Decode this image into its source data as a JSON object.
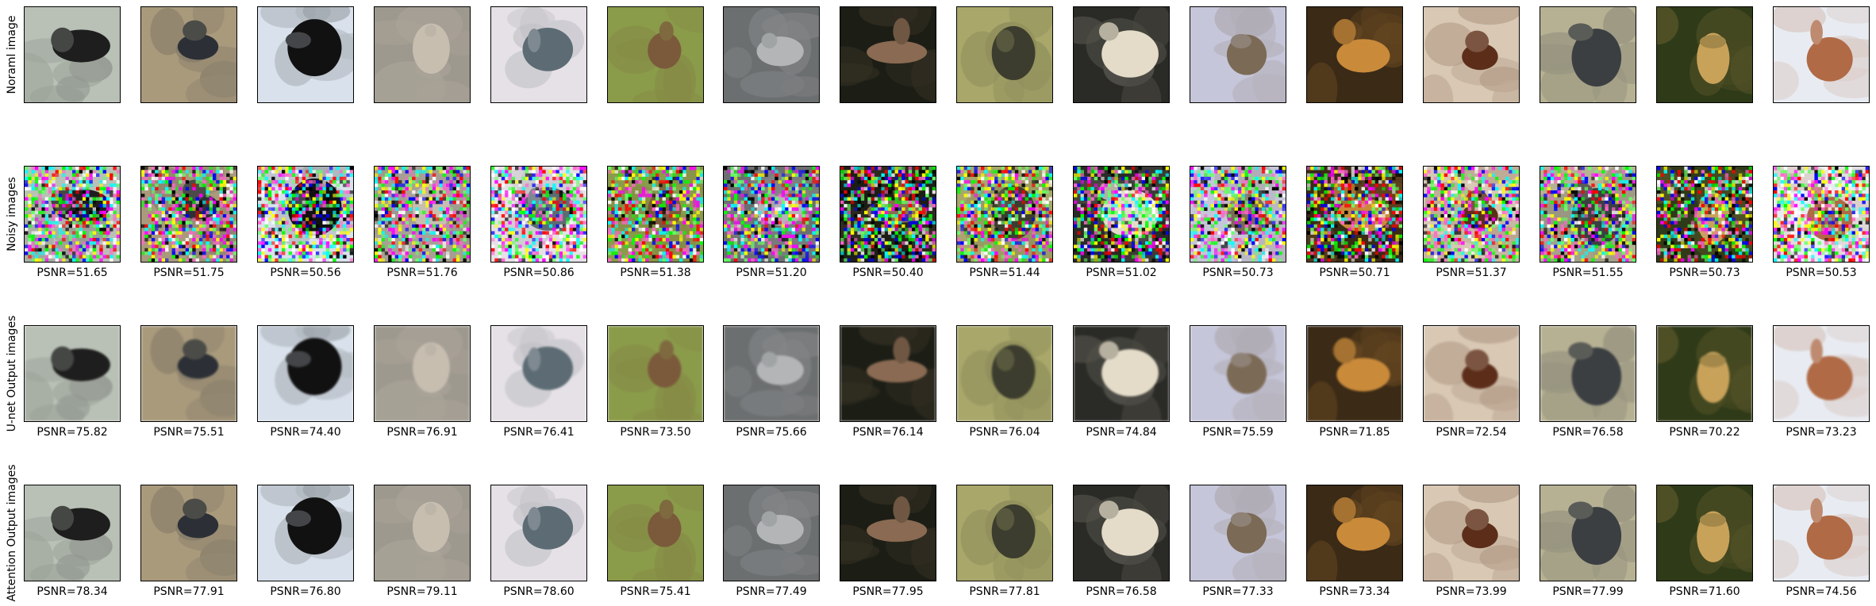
{
  "rows": [
    {
      "label": "Noraml image",
      "psnr": []
    },
    {
      "label": "Noisy images",
      "psnr": [
        "PSNR=51.65",
        "PSNR=51.75",
        "PSNR=50.56",
        "PSNR=51.76",
        "PSNR=50.86",
        "PSNR=51.38",
        "PSNR=51.20",
        "PSNR=50.40",
        "PSNR=51.44",
        "PSNR=51.02",
        "PSNR=50.73",
        "PSNR=50.71",
        "PSNR=51.37",
        "PSNR=51.55",
        "PSNR=50.73",
        "PSNR=50.53"
      ]
    },
    {
      "label": "U-net Output images",
      "psnr": [
        "PSNR=75.82",
        "PSNR=75.51",
        "PSNR=74.40",
        "PSNR=76.91",
        "PSNR=76.41",
        "PSNR=73.50",
        "PSNR=75.66",
        "PSNR=76.14",
        "PSNR=76.04",
        "PSNR=74.84",
        "PSNR=75.59",
        "PSNR=71.85",
        "PSNR=72.54",
        "PSNR=76.58",
        "PSNR=70.22",
        "PSNR=73.23"
      ]
    },
    {
      "label": "Attention Output images",
      "psnr": [
        "PSNR=78.34",
        "PSNR=77.91",
        "PSNR=76.80",
        "PSNR=79.11",
        "PSNR=78.60",
        "PSNR=75.41",
        "PSNR=77.49",
        "PSNR=77.95",
        "PSNR=77.81",
        "PSNR=76.58",
        "PSNR=77.33",
        "PSNR=73.34",
        "PSNR=73.99",
        "PSNR=77.99",
        "PSNR=71.60",
        "PSNR=74.56"
      ]
    }
  ],
  "images": [
    {
      "subject": "bird",
      "bg": "#b9c1b6",
      "fg": "#1e1e1e"
    },
    {
      "subject": "bird",
      "bg": "#a99a7c",
      "fg": "#2c3036"
    },
    {
      "subject": "bird",
      "bg": "#d9e2ec",
      "fg": "#111111"
    },
    {
      "subject": "cat",
      "bg": "#9e998f",
      "fg": "#c7beb0"
    },
    {
      "subject": "ship",
      "bg": "#e6e1e6",
      "fg": "#5d6c74"
    },
    {
      "subject": "deer",
      "bg": "#8a9b4a",
      "fg": "#7b5a3b"
    },
    {
      "subject": "automobile",
      "bg": "#6c6f70",
      "fg": "#b3b5b6"
    },
    {
      "subject": "bird",
      "bg": "#1c1e16",
      "fg": "#8a6a52"
    },
    {
      "subject": "bird",
      "bg": "#a9a76a",
      "fg": "#3c3d2e"
    },
    {
      "subject": "automobile",
      "bg": "#2a2a26",
      "fg": "#e4dcc9"
    },
    {
      "subject": "bird",
      "bg": "#c6c6da",
      "fg": "#7b6a55"
    },
    {
      "subject": "deer",
      "bg": "#3a2a16",
      "fg": "#c98a3a"
    },
    {
      "subject": "horse",
      "bg": "#d8c8b4",
      "fg": "#5c2e1a"
    },
    {
      "subject": "bird",
      "bg": "#b7b194",
      "fg": "#3b3f42"
    },
    {
      "subject": "frog",
      "bg": "#2f3a18",
      "fg": "#c9a25a"
    },
    {
      "subject": "horse",
      "bg": "#e8ecf2",
      "fg": "#b06a45"
    }
  ]
}
